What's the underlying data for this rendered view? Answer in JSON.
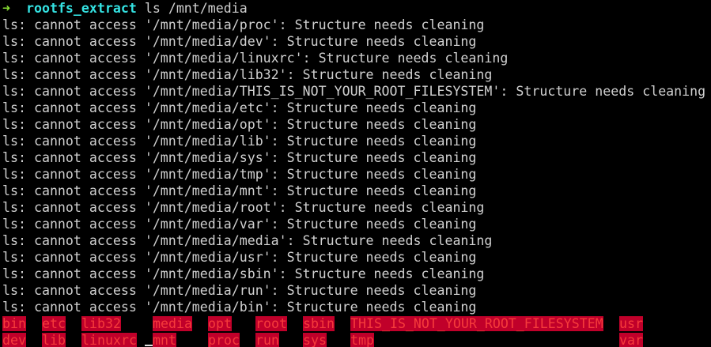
{
  "prompt": {
    "arrow": "➜",
    "directory": "rootfs_extract",
    "command": "ls /mnt/media"
  },
  "errors": [
    "ls: cannot access '/mnt/media/proc': Structure needs cleaning",
    "ls: cannot access '/mnt/media/dev': Structure needs cleaning",
    "ls: cannot access '/mnt/media/linuxrc': Structure needs cleaning",
    "ls: cannot access '/mnt/media/lib32': Structure needs cleaning",
    "ls: cannot access '/mnt/media/THIS_IS_NOT_YOUR_ROOT_FILESYSTEM': Structure needs cleaning",
    "ls: cannot access '/mnt/media/etc': Structure needs cleaning",
    "ls: cannot access '/mnt/media/opt': Structure needs cleaning",
    "ls: cannot access '/mnt/media/lib': Structure needs cleaning",
    "ls: cannot access '/mnt/media/sys': Structure needs cleaning",
    "ls: cannot access '/mnt/media/tmp': Structure needs cleaning",
    "ls: cannot access '/mnt/media/mnt': Structure needs cleaning",
    "ls: cannot access '/mnt/media/root': Structure needs cleaning",
    "ls: cannot access '/mnt/media/var': Structure needs cleaning",
    "ls: cannot access '/mnt/media/media': Structure needs cleaning",
    "ls: cannot access '/mnt/media/usr': Structure needs cleaning",
    "ls: cannot access '/mnt/media/sbin': Structure needs cleaning",
    "ls: cannot access '/mnt/media/run': Structure needs cleaning",
    "ls: cannot access '/mnt/media/bin': Structure needs cleaning"
  ],
  "listing": {
    "row1": [
      "bin",
      "etc",
      "lib32",
      "media",
      "opt",
      "root",
      "sbin",
      "THIS_IS_NOT_YOUR_ROOT_FILESYSTEM",
      "usr"
    ],
    "row2": [
      "dev",
      "lib",
      "linuxrc",
      "mnt",
      "proc",
      "run",
      "sys",
      "tmp",
      "var"
    ]
  },
  "colors": {
    "background": "#000000",
    "text": "#d0d0d0",
    "prompt_arrow": "#8ae234",
    "prompt_dir": "#34e2e2",
    "ls_item_bg": "#c0002a",
    "ls_item_fg": "#f53b3b"
  }
}
